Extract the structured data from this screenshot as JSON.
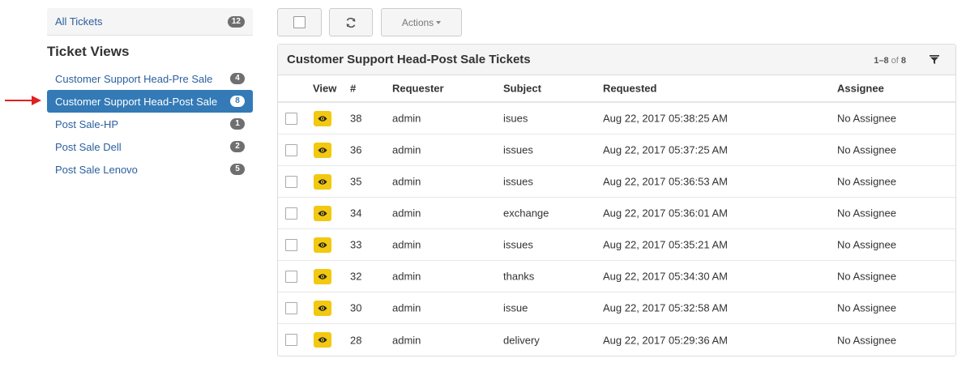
{
  "sidebar": {
    "all_tickets": {
      "label": "All Tickets",
      "count": "12"
    },
    "views_title": "Ticket Views",
    "views": [
      {
        "label": "Customer Support Head-Pre Sale",
        "count": "4"
      },
      {
        "label": "Customer Support Head-Post Sale",
        "count": "8"
      },
      {
        "label": "Post Sale-HP",
        "count": "1"
      },
      {
        "label": "Post Sale Dell",
        "count": "2"
      },
      {
        "label": "Post Sale Lenovo",
        "count": "5"
      }
    ],
    "active_view_index": 1,
    "arrow_color": "#e02020"
  },
  "toolbar": {
    "actions_label": "Actions"
  },
  "panel": {
    "title": "Customer Support Head-Post Sale Tickets",
    "pager_range": "1–8",
    "pager_of": "of",
    "pager_total": "8"
  },
  "table": {
    "headers": {
      "view": "View",
      "num": "#",
      "requester": "Requester",
      "subject": "Subject",
      "requested": "Requested",
      "assignee": "Assignee"
    },
    "rows": [
      {
        "num": "38",
        "requester": "admin",
        "subject": "isues",
        "requested": "Aug 22, 2017 05:38:25 AM",
        "assignee": "No Assignee"
      },
      {
        "num": "36",
        "requester": "admin",
        "subject": "issues",
        "requested": "Aug 22, 2017 05:37:25 AM",
        "assignee": "No Assignee"
      },
      {
        "num": "35",
        "requester": "admin",
        "subject": "issues",
        "requested": "Aug 22, 2017 05:36:53 AM",
        "assignee": "No Assignee"
      },
      {
        "num": "34",
        "requester": "admin",
        "subject": "exchange",
        "requested": "Aug 22, 2017 05:36:01 AM",
        "assignee": "No Assignee"
      },
      {
        "num": "33",
        "requester": "admin",
        "subject": "issues",
        "requested": "Aug 22, 2017 05:35:21 AM",
        "assignee": "No Assignee"
      },
      {
        "num": "32",
        "requester": "admin",
        "subject": "thanks",
        "requested": "Aug 22, 2017 05:34:30 AM",
        "assignee": "No Assignee"
      },
      {
        "num": "30",
        "requester": "admin",
        "subject": "issue",
        "requested": "Aug 22, 2017 05:32:58 AM",
        "assignee": "No Assignee"
      },
      {
        "num": "28",
        "requester": "admin",
        "subject": "delivery",
        "requested": "Aug 22, 2017 05:29:36 AM",
        "assignee": "No Assignee"
      }
    ]
  },
  "colors": {
    "accent": "#337ab7",
    "link": "#2b5f9e",
    "view_button": "#f2c811"
  },
  "icons": {
    "refresh": "refresh-icon",
    "filter": "filter-icon",
    "view": "eye-icon"
  }
}
